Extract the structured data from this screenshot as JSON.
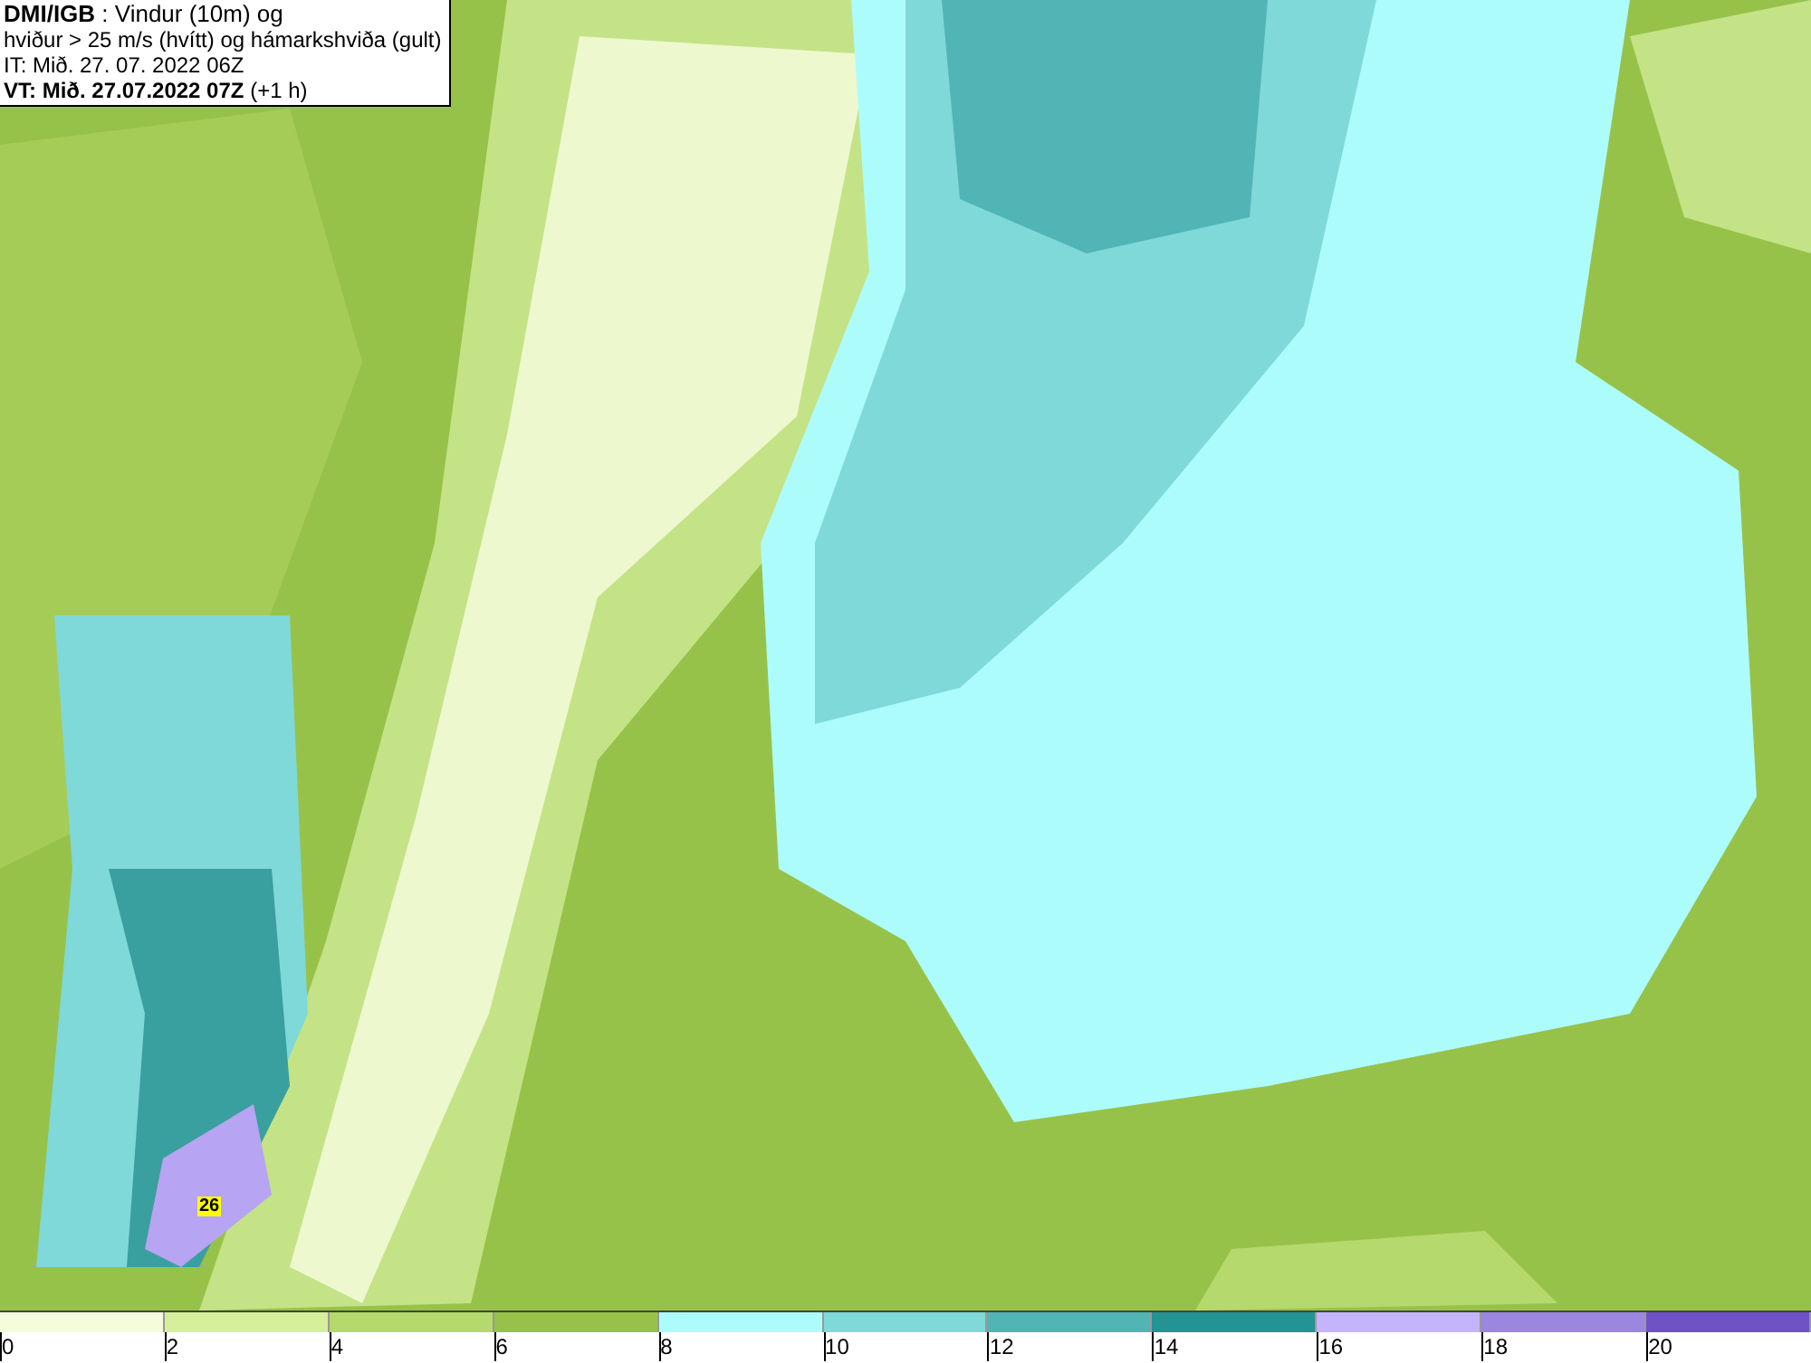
{
  "header": {
    "lines": [
      "**DMI/IGB** : Vindur (10m) og",
      "hviður > 25 m/s (hvítt) og hámarkshviða (gult)",
      "IT: Mið. 27. 07. 2022 06Z",
      "**VT: Mið. 27.07.2022 07Z** (+1 h)"
    ]
  },
  "map": {
    "gust_label": "26"
  },
  "legend": {
    "bins": [
      {
        "color": "#f5fcdc"
      },
      {
        "color": "#d6ef9a"
      },
      {
        "color": "#b5d96c"
      },
      {
        "color": "#97c24a"
      },
      {
        "color": "#adfcfc"
      },
      {
        "color": "#7fd9d9"
      },
      {
        "color": "#52b5b5"
      },
      {
        "color": "#239393"
      },
      {
        "color": "#c4b4fc"
      },
      {
        "color": "#9b86e0"
      },
      {
        "color": "#6e52c6"
      }
    ],
    "ticks": [
      "0",
      "2",
      "4",
      "6",
      "8",
      "10",
      "12",
      "14",
      "16",
      "18",
      "20"
    ]
  }
}
